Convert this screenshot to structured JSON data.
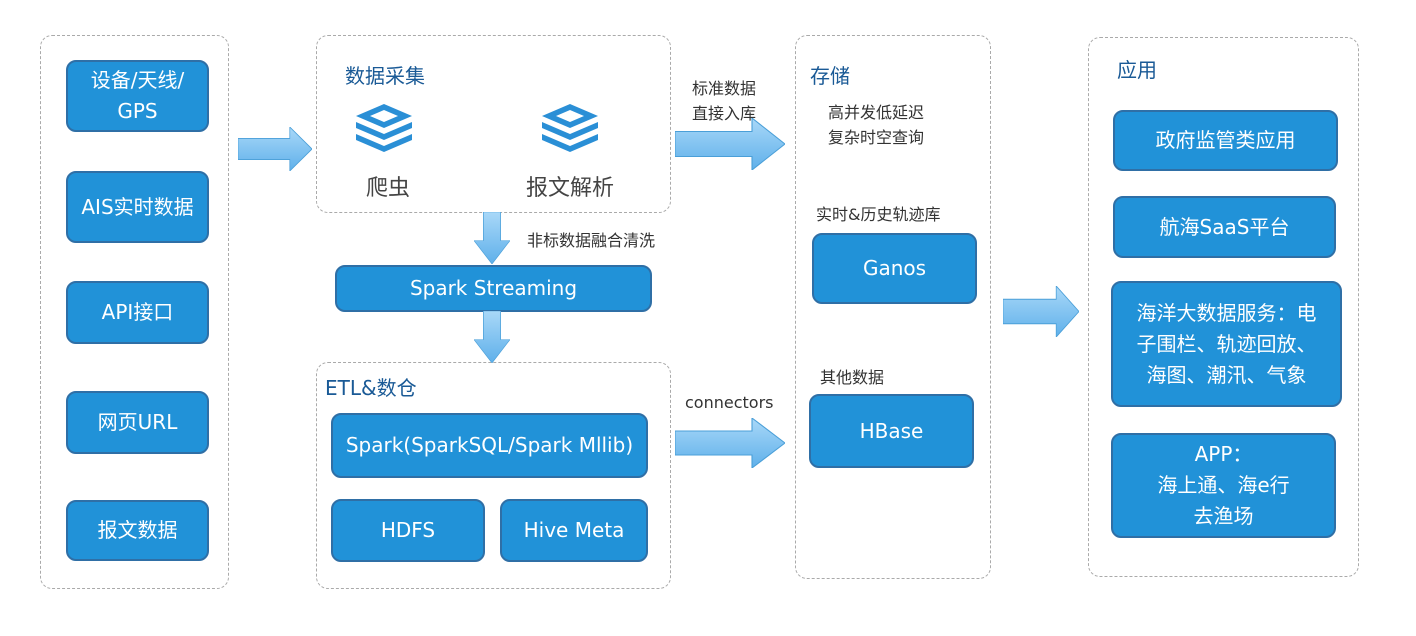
{
  "sources": {
    "items": [
      "设备/天线/\nGPS",
      "AIS实时数据",
      "API接口",
      "网页URL",
      "报文数据"
    ]
  },
  "collect": {
    "title": "数据采集",
    "crawler": "爬虫",
    "parser": "报文解析",
    "icon": "stack-icon"
  },
  "clean_label": "非标数据融合清洗",
  "streaming": "Spark Streaming",
  "etl": {
    "title": "ETL&数仓",
    "spark": "Spark(SparkSQL/Spark Mllib)",
    "hdfs": "HDFS",
    "hive": "Hive Meta"
  },
  "direct_label": "标准数据\n直接入库",
  "connectors_label": "connectors",
  "storage": {
    "title": "存储",
    "desc": "高并发低延迟\n复杂时空查询",
    "track_label": "实时&历史轨迹库",
    "ganos": "Ganos",
    "other_label": "其他数据",
    "hbase": "HBase"
  },
  "apps": {
    "title": "应用",
    "items": [
      "政府监管类应用",
      "航海SaaS平台",
      "海洋大数据服务：电\n子围栏、轨迹回放、\n海图、潮汛、气象",
      "APP：\n海上通、海e行\n去渔场"
    ]
  },
  "colors": {
    "box": "#2192d8",
    "title": "#1a5a96",
    "arrow": "#7cc0ee"
  }
}
